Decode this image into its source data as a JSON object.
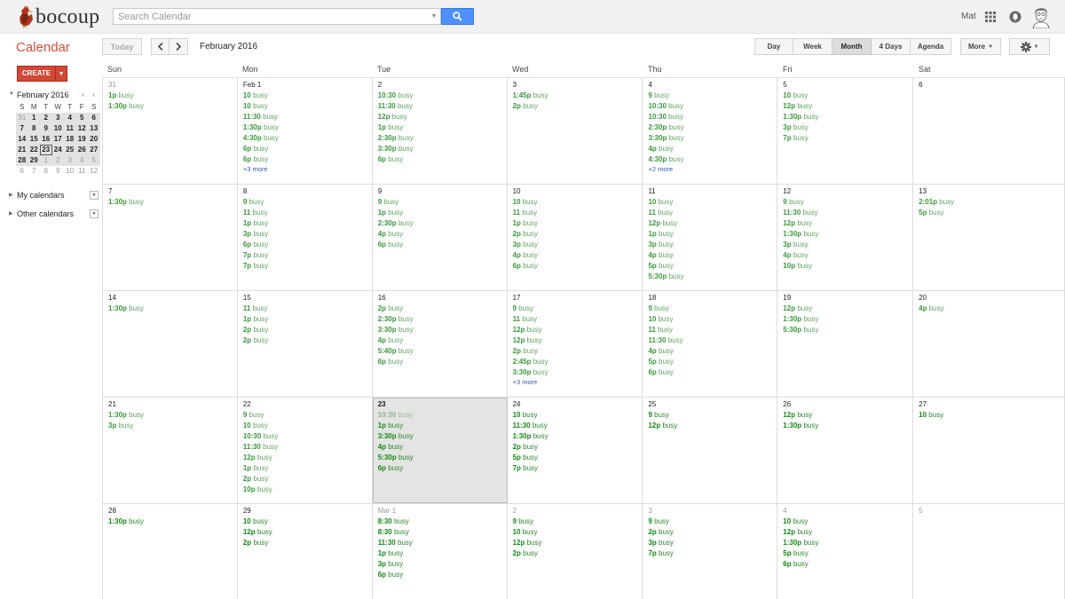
{
  "brand": {
    "name": "bocoup"
  },
  "search": {
    "placeholder": "Search Calendar",
    "value": ""
  },
  "user": {
    "name": "Mat"
  },
  "app": {
    "title": "Calendar"
  },
  "toolbar": {
    "today_label": "Today",
    "current_period": "February 2016",
    "views": [
      "Day",
      "Week",
      "Month",
      "4 Days",
      "Agenda"
    ],
    "active_view": "Month",
    "more_label": "More"
  },
  "sidebar": {
    "create_label": "CREATE",
    "mini_calendar": {
      "title": "February 2016",
      "days_of_week": [
        "S",
        "M",
        "T",
        "W",
        "T",
        "F",
        "S"
      ],
      "weeks": [
        [
          "31",
          "1",
          "2",
          "3",
          "4",
          "5",
          "6"
        ],
        [
          "7",
          "8",
          "9",
          "10",
          "11",
          "12",
          "13"
        ],
        [
          "14",
          "15",
          "16",
          "17",
          "18",
          "19",
          "20"
        ],
        [
          "21",
          "22",
          "23",
          "24",
          "25",
          "26",
          "27"
        ],
        [
          "28",
          "29",
          "1",
          "2",
          "3",
          "4",
          "5"
        ],
        [
          "6",
          "7",
          "8",
          "9",
          "10",
          "11",
          "12"
        ]
      ],
      "today": "23"
    },
    "my_calendars_label": "My calendars",
    "other_calendars_label": "Other calendars"
  },
  "colors": {
    "accent": "#dd4b39",
    "create": "#d14836",
    "search_button": "#4d90fe",
    "event": "#3a9a3a",
    "link": "#2f5fb3"
  },
  "calendar": {
    "day_names": [
      "Sun",
      "Mon",
      "Tue",
      "Wed",
      "Thu",
      "Fri",
      "Sat"
    ],
    "weeks": [
      [
        {
          "label": "31",
          "other": true,
          "events": [
            [
              "1p",
              "busy"
            ],
            [
              "1:30p",
              "busy"
            ]
          ]
        },
        {
          "label": "Feb 1",
          "events": [
            [
              "10",
              "busy"
            ],
            [
              "10",
              "busy"
            ],
            [
              "11:30",
              "busy"
            ],
            [
              "1:30p",
              "busy"
            ],
            [
              "4:30p",
              "busy"
            ],
            [
              "6p",
              "busy"
            ],
            [
              "6p",
              "busy"
            ]
          ],
          "more": "+3 more"
        },
        {
          "label": "2",
          "events": [
            [
              "10:30",
              "busy"
            ],
            [
              "11:30",
              "busy"
            ],
            [
              "12p",
              "busy"
            ],
            [
              "1p",
              "busy"
            ],
            [
              "2:30p",
              "busy"
            ],
            [
              "3:30p",
              "busy"
            ],
            [
              "6p",
              "busy"
            ]
          ]
        },
        {
          "label": "3",
          "events": [
            [
              "1:45p",
              "busy"
            ],
            [
              "2p",
              "busy"
            ]
          ]
        },
        {
          "label": "4",
          "events": [
            [
              "9",
              "busy"
            ],
            [
              "10:30",
              "busy"
            ],
            [
              "10:30",
              "busy"
            ],
            [
              "2:30p",
              "busy"
            ],
            [
              "3:30p",
              "busy"
            ],
            [
              "4p",
              "busy"
            ],
            [
              "4:30p",
              "busy"
            ]
          ],
          "more": "+2 more"
        },
        {
          "label": "5",
          "events": [
            [
              "10",
              "busy"
            ],
            [
              "12p",
              "busy"
            ],
            [
              "1:30p",
              "busy"
            ],
            [
              "3p",
              "busy"
            ],
            [
              "7p",
              "busy"
            ]
          ]
        },
        {
          "label": "6",
          "events": []
        }
      ],
      [
        {
          "label": "7",
          "events": [
            [
              "1:30p",
              "busy"
            ]
          ]
        },
        {
          "label": "8",
          "events": [
            [
              "9",
              "busy"
            ],
            [
              "11",
              "busy"
            ],
            [
              "1p",
              "busy"
            ],
            [
              "3p",
              "busy"
            ],
            [
              "6p",
              "busy"
            ],
            [
              "7p",
              "busy"
            ],
            [
              "7p",
              "busy"
            ]
          ]
        },
        {
          "label": "9",
          "events": [
            [
              "9",
              "busy"
            ],
            [
              "1p",
              "busy"
            ],
            [
              "2:30p",
              "busy"
            ],
            [
              "4p",
              "busy"
            ],
            [
              "6p",
              "busy"
            ]
          ]
        },
        {
          "label": "10",
          "events": [
            [
              "10",
              "busy"
            ],
            [
              "11",
              "busy"
            ],
            [
              "1p",
              "busy"
            ],
            [
              "2p",
              "busy"
            ],
            [
              "3p",
              "busy"
            ],
            [
              "4p",
              "busy"
            ],
            [
              "6p",
              "busy"
            ]
          ]
        },
        {
          "label": "11",
          "events": [
            [
              "10",
              "busy"
            ],
            [
              "11",
              "busy"
            ],
            [
              "12p",
              "busy"
            ],
            [
              "1p",
              "busy"
            ],
            [
              "3p",
              "busy"
            ],
            [
              "4p",
              "busy"
            ],
            [
              "5p",
              "busy"
            ],
            [
              "5:30p",
              "busy"
            ]
          ]
        },
        {
          "label": "12",
          "events": [
            [
              "9",
              "busy"
            ],
            [
              "11:30",
              "busy"
            ],
            [
              "12p",
              "busy"
            ],
            [
              "1:30p",
              "busy"
            ],
            [
              "3p",
              "busy"
            ],
            [
              "4p",
              "busy"
            ],
            [
              "10p",
              "busy"
            ]
          ]
        },
        {
          "label": "13",
          "events": [
            [
              "2:01p",
              "busy"
            ],
            [
              "5p",
              "busy"
            ]
          ]
        }
      ],
      [
        {
          "label": "14",
          "events": [
            [
              "1:30p",
              "busy"
            ]
          ]
        },
        {
          "label": "15",
          "events": [
            [
              "11",
              "busy"
            ],
            [
              "1p",
              "busy"
            ],
            [
              "2p",
              "busy"
            ],
            [
              "2p",
              "busy"
            ]
          ]
        },
        {
          "label": "16",
          "events": [
            [
              "2p",
              "busy"
            ],
            [
              "2:30p",
              "busy"
            ],
            [
              "3:30p",
              "busy"
            ],
            [
              "4p",
              "busy"
            ],
            [
              "5:40p",
              "busy"
            ],
            [
              "6p",
              "busy"
            ]
          ]
        },
        {
          "label": "17",
          "events": [
            [
              "9",
              "busy"
            ],
            [
              "11",
              "busy"
            ],
            [
              "12p",
              "busy"
            ],
            [
              "12p",
              "busy"
            ],
            [
              "2p",
              "busy"
            ],
            [
              "2:45p",
              "busy"
            ],
            [
              "3:30p",
              "busy"
            ]
          ],
          "more": "+3 more"
        },
        {
          "label": "18",
          "events": [
            [
              "9",
              "busy"
            ],
            [
              "10",
              "busy"
            ],
            [
              "11",
              "busy"
            ],
            [
              "11:30",
              "busy"
            ],
            [
              "4p",
              "busy"
            ],
            [
              "5p",
              "busy"
            ],
            [
              "6p",
              "busy"
            ]
          ]
        },
        {
          "label": "19",
          "events": [
            [
              "12p",
              "busy"
            ],
            [
              "1:30p",
              "busy"
            ],
            [
              "5:30p",
              "busy"
            ]
          ]
        },
        {
          "label": "20",
          "events": [
            [
              "4p",
              "busy"
            ]
          ]
        }
      ],
      [
        {
          "label": "21",
          "events": [
            [
              "1:30p",
              "busy"
            ],
            [
              "3p",
              "busy"
            ]
          ]
        },
        {
          "label": "22",
          "events": [
            [
              "9",
              "busy"
            ],
            [
              "10",
              "busy"
            ],
            [
              "10:30",
              "busy"
            ],
            [
              "11:30",
              "busy"
            ],
            [
              "12p",
              "busy"
            ],
            [
              "1p",
              "busy"
            ],
            [
              "2p",
              "busy"
            ],
            [
              "10p",
              "busy"
            ]
          ]
        },
        {
          "label": "23",
          "today": true,
          "events": [
            [
              "10:30",
              "busy",
              true
            ],
            [
              "1p",
              "busy"
            ],
            [
              "3:30p",
              "busy"
            ],
            [
              "4p",
              "busy"
            ],
            [
              "5:30p",
              "busy"
            ],
            [
              "6p",
              "busy"
            ]
          ]
        },
        {
          "label": "24",
          "future": true,
          "events": [
            [
              "10",
              "busy"
            ],
            [
              "11:30",
              "busy"
            ],
            [
              "1:30p",
              "busy"
            ],
            [
              "2p",
              "busy"
            ],
            [
              "5p",
              "busy"
            ],
            [
              "7p",
              "busy"
            ]
          ]
        },
        {
          "label": "25",
          "future": true,
          "events": [
            [
              "9",
              "busy"
            ],
            [
              "12p",
              "busy"
            ]
          ]
        },
        {
          "label": "26",
          "future": true,
          "events": [
            [
              "12p",
              "busy"
            ],
            [
              "1:30p",
              "busy"
            ]
          ]
        },
        {
          "label": "27",
          "future": true,
          "events": [
            [
              "10",
              "busy"
            ]
          ]
        }
      ],
      [
        {
          "label": "28",
          "future": true,
          "events": [
            [
              "1:30p",
              "busy"
            ]
          ]
        },
        {
          "label": "29",
          "future": true,
          "events": [
            [
              "10",
              "busy"
            ],
            [
              "12p",
              "busy"
            ],
            [
              "2p",
              "busy"
            ]
          ]
        },
        {
          "label": "Mar 1",
          "other": true,
          "future": true,
          "events": [
            [
              "8:30",
              "busy"
            ],
            [
              "8:30",
              "busy"
            ],
            [
              "11:30",
              "busy"
            ],
            [
              "1p",
              "busy"
            ],
            [
              "3p",
              "busy"
            ],
            [
              "6p",
              "busy"
            ]
          ]
        },
        {
          "label": "2",
          "other": true,
          "future": true,
          "events": [
            [
              "9",
              "busy"
            ],
            [
              "10",
              "busy"
            ],
            [
              "12p",
              "busy"
            ],
            [
              "2p",
              "busy"
            ]
          ]
        },
        {
          "label": "3",
          "other": true,
          "future": true,
          "events": [
            [
              "9",
              "busy"
            ],
            [
              "2p",
              "busy"
            ],
            [
              "3p",
              "busy"
            ],
            [
              "7p",
              "busy"
            ]
          ]
        },
        {
          "label": "4",
          "other": true,
          "future": true,
          "events": [
            [
              "10",
              "busy"
            ],
            [
              "12p",
              "busy"
            ],
            [
              "1:30p",
              "busy"
            ],
            [
              "5p",
              "busy"
            ],
            [
              "6p",
              "busy"
            ]
          ]
        },
        {
          "label": "5",
          "other": true,
          "future": true,
          "events": []
        }
      ]
    ]
  }
}
